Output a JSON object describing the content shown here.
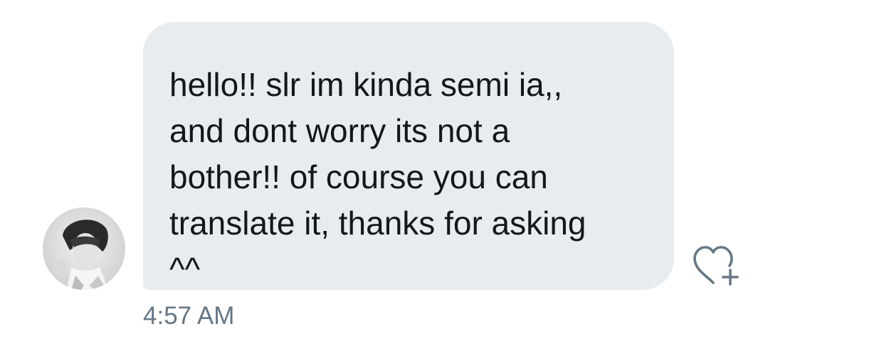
{
  "message": {
    "text": "hello!! slr im kinda semi ia,,\nand dont worry its not a\nbother!! of course you can\ntranslate it, thanks for asking\n^^",
    "timestamp": "4:57 AM"
  },
  "icons": {
    "avatar": "profile-photo",
    "like": "heart-plus-icon"
  },
  "colors": {
    "bubble": "#e7ecf0",
    "text": "#14171a",
    "timestamp": "#657786",
    "icon": "#657786"
  }
}
